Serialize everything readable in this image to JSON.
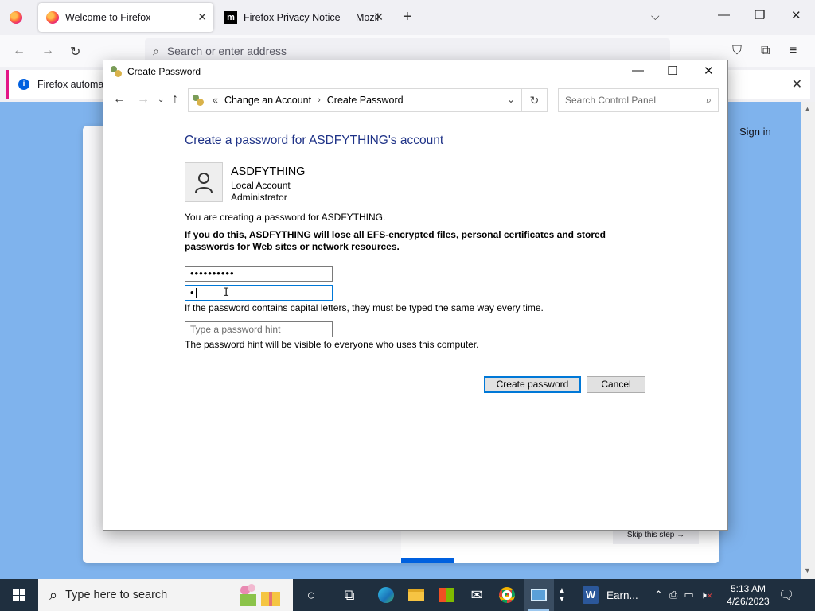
{
  "firefox": {
    "tabs": [
      {
        "title": "Welcome to Firefox",
        "active": true
      },
      {
        "title": "Firefox Privacy Notice — Mozill",
        "active": false
      }
    ],
    "urlbar_placeholder": "Search or enter address",
    "notice_text": "Firefox automati",
    "sign_in": "Sign in",
    "skip_step": "Skip this step →"
  },
  "dialog": {
    "title": "Create Password",
    "breadcrumb": {
      "parent": "Change an Account",
      "current": "Create Password"
    },
    "search_placeholder": "Search Control Panel",
    "heading": "Create a password for ASDFYTHING's account",
    "account": {
      "name": "ASDFYTHING",
      "type": "Local Account",
      "role": "Administrator"
    },
    "creating_text": "You are creating a password for ASDFYTHING.",
    "warning_text": "If you do this, ASDFYTHING will lose all EFS-encrypted files, personal certificates and stored passwords for Web sites or network resources.",
    "new_password_value": "••••••••••",
    "confirm_password_value": "•",
    "caps_note": "If the password contains capital letters, they must be typed the same way every time.",
    "hint_placeholder": "Type a password hint",
    "hint_note": "The password hint will be visible to everyone who uses this computer.",
    "create_button": "Create password",
    "cancel_button": "Cancel"
  },
  "taskbar": {
    "search_placeholder": "Type here to search",
    "word_app_label": "Earn...",
    "time": "5:13 AM",
    "date": "4/26/2023"
  },
  "colors": {
    "heading_blue": "#1e3287",
    "focus_blue": "#0078d7",
    "taskbar_bg": "#1f2f3f",
    "firefox_bg": "#7fb3ed"
  }
}
